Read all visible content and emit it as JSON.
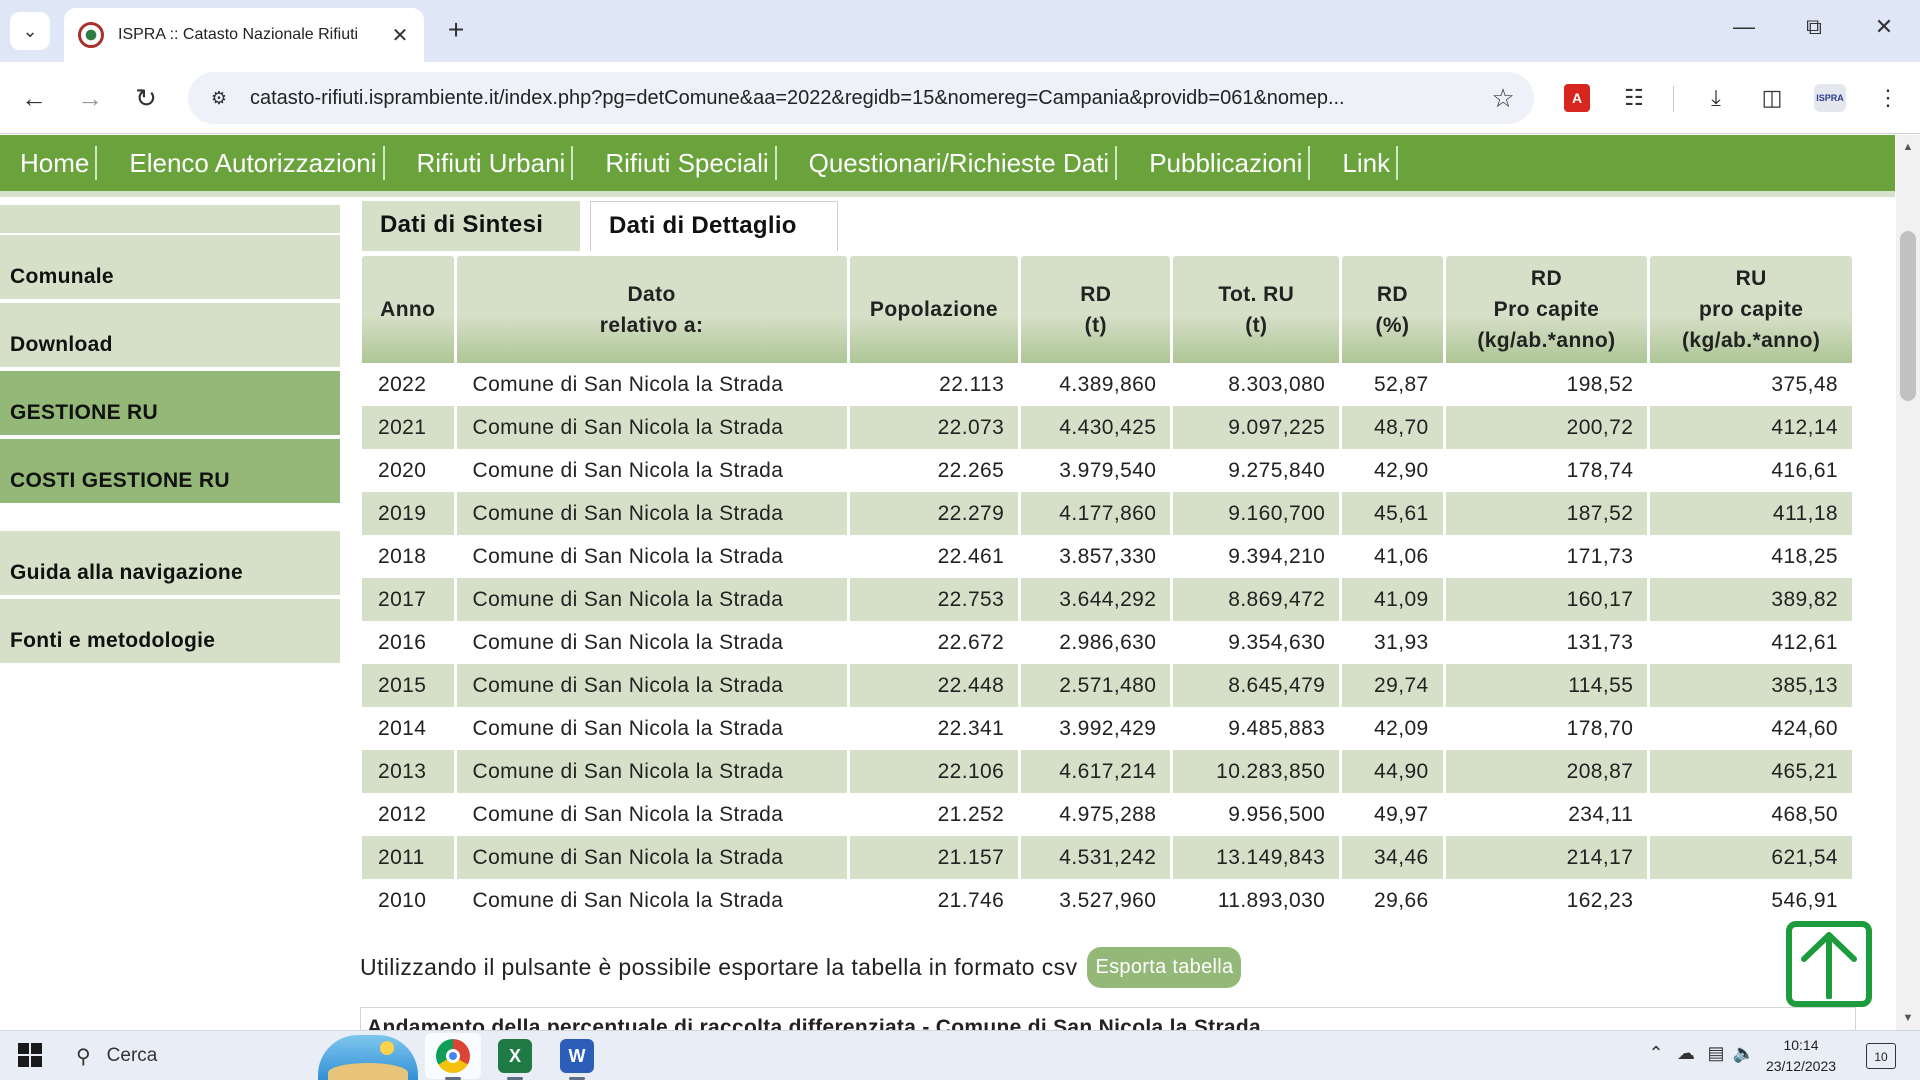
{
  "browser": {
    "tab_title": "ISPRA :: Catasto Nazionale Rifiuti",
    "url": "catasto-rifiuti.isprambiente.it/index.php?pg=detComune&aa=2022&regidb=15&nomereg=Campania&providb=061&nomep...",
    "profile_label": "ISPRA"
  },
  "topnav": [
    "Home",
    "Elenco Autorizzazioni",
    "Rifiuti Urbani",
    "Rifiuti Speciali",
    "Questionari/Richieste Dati",
    "Pubblicazioni",
    "Link"
  ],
  "sidebar": {
    "items": [
      "Comunale",
      "Download",
      "GESTIONE RU",
      "COSTI GESTIONE RU",
      "Guida alla navigazione",
      "Fonti e metodologie"
    ]
  },
  "tabs": {
    "sintesi": "Dati di Sintesi",
    "dettaglio": "Dati di Dettaglio"
  },
  "table": {
    "headers": [
      [
        "Anno"
      ],
      [
        "Dato",
        "relativo a:"
      ],
      [
        "Popolazione"
      ],
      [
        "RD",
        "(t)"
      ],
      [
        "Tot. RU",
        "(t)"
      ],
      [
        "RD",
        "(%)"
      ],
      [
        "RD",
        "Pro capite",
        "(kg/ab.*anno)"
      ],
      [
        "RU",
        "pro capite",
        "(kg/ab.*anno)"
      ]
    ],
    "rows": [
      [
        "2022",
        "Comune di San Nicola la Strada",
        "22.113",
        "4.389,860",
        "8.303,080",
        "52,87",
        "198,52",
        "375,48"
      ],
      [
        "2021",
        "Comune di San Nicola la Strada",
        "22.073",
        "4.430,425",
        "9.097,225",
        "48,70",
        "200,72",
        "412,14"
      ],
      [
        "2020",
        "Comune di San Nicola la Strada",
        "22.265",
        "3.979,540",
        "9.275,840",
        "42,90",
        "178,74",
        "416,61"
      ],
      [
        "2019",
        "Comune di San Nicola la Strada",
        "22.279",
        "4.177,860",
        "9.160,700",
        "45,61",
        "187,52",
        "411,18"
      ],
      [
        "2018",
        "Comune di San Nicola la Strada",
        "22.461",
        "3.857,330",
        "9.394,210",
        "41,06",
        "171,73",
        "418,25"
      ],
      [
        "2017",
        "Comune di San Nicola la Strada",
        "22.753",
        "3.644,292",
        "8.869,472",
        "41,09",
        "160,17",
        "389,82"
      ],
      [
        "2016",
        "Comune di San Nicola la Strada",
        "22.672",
        "2.986,630",
        "9.354,630",
        "31,93",
        "131,73",
        "412,61"
      ],
      [
        "2015",
        "Comune di San Nicola la Strada",
        "22.448",
        "2.571,480",
        "8.645,479",
        "29,74",
        "114,55",
        "385,13"
      ],
      [
        "2014",
        "Comune di San Nicola la Strada",
        "22.341",
        "3.992,429",
        "9.485,883",
        "42,09",
        "178,70",
        "424,60"
      ],
      [
        "2013",
        "Comune di San Nicola la Strada",
        "22.106",
        "4.617,214",
        "10.283,850",
        "44,90",
        "208,87",
        "465,21"
      ],
      [
        "2012",
        "Comune di San Nicola la Strada",
        "21.252",
        "4.975,288",
        "9.956,500",
        "49,97",
        "234,11",
        "468,50"
      ],
      [
        "2011",
        "Comune di San Nicola la Strada",
        "21.157",
        "4.531,242",
        "13.149,843",
        "34,46",
        "214,17",
        "621,54"
      ],
      [
        "2010",
        "Comune di San Nicola la Strada",
        "21.746",
        "3.527,960",
        "11.893,030",
        "29,66",
        "162,23",
        "546,91"
      ]
    ]
  },
  "export": {
    "text": "Utilizzando il pulsante è possibile esportare la tabella in formato csv",
    "button": "Esporta tabella"
  },
  "chart_title": "Andamento della percentuale di raccolta differenziata - Comune di San Nicola la Strada",
  "taskbar": {
    "search_label": "Cerca",
    "time": "10:14",
    "date": "23/12/2023",
    "notifications": "10"
  },
  "colors": {
    "nav_green": "#6aa23c",
    "light_green": "#d6e0c8",
    "mid_green": "#94b877",
    "back_to_top": "#1c9c3c"
  }
}
